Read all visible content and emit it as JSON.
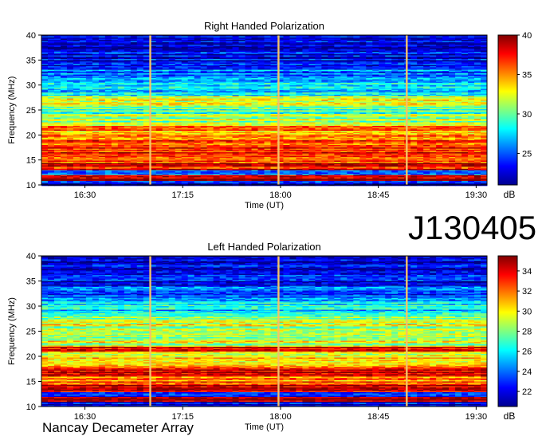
{
  "figure_label": "J130405",
  "footer": "Nancay Decameter Array",
  "chart_data": [
    {
      "type": "heatmap",
      "title": "Right Handed Polarization",
      "xlabel": "Time (UT)",
      "ylabel": "Frequency (MHz)",
      "xticks": [
        "16:30",
        "17:15",
        "18:00",
        "18:45",
        "19:30"
      ],
      "yticks": [
        "10",
        "15",
        "20",
        "25",
        "30",
        "35",
        "40"
      ],
      "ylim": [
        10,
        40
      ],
      "colorbar_label": "dB",
      "colorbar_ticks": [
        "25",
        "30",
        "35",
        "40"
      ],
      "colorbar_range": [
        21,
        40
      ],
      "band_levels": [
        {
          "freq_range": [
            10.0,
            11.0
          ],
          "level": 23
        },
        {
          "freq_range": [
            11.0,
            12.0
          ],
          "level": 39
        },
        {
          "freq_range": [
            12.0,
            13.0
          ],
          "level": 24
        },
        {
          "freq_range": [
            13.0,
            14.5
          ],
          "level": 38
        },
        {
          "freq_range": [
            14.5,
            16.0
          ],
          "level": 36
        },
        {
          "freq_range": [
            16.0,
            18.0
          ],
          "level": 37
        },
        {
          "freq_range": [
            18.0,
            20.0
          ],
          "level": 36
        },
        {
          "freq_range": [
            20.0,
            21.0
          ],
          "level": 34
        },
        {
          "freq_range": [
            21.0,
            22.0
          ],
          "level": 38
        },
        {
          "freq_range": [
            22.0,
            24.0
          ],
          "level": 31
        },
        {
          "freq_range": [
            24.0,
            26.0
          ],
          "level": 30
        },
        {
          "freq_range": [
            26.0,
            28.0
          ],
          "level": 32
        },
        {
          "freq_range": [
            28.0,
            31.0
          ],
          "level": 27
        },
        {
          "freq_range": [
            31.0,
            34.0
          ],
          "level": 25
        },
        {
          "freq_range": [
            34.0,
            40.0
          ],
          "level": 23
        }
      ],
      "vertical_markers_time": [
        "17:00",
        "17:59",
        "18:58"
      ]
    },
    {
      "type": "heatmap",
      "title": "Left Handed Polarization",
      "xlabel": "Time (UT)",
      "ylabel": "Frequency (MHz)",
      "xticks": [
        "16:30",
        "17:15",
        "18:00",
        "18:45",
        "19:30"
      ],
      "yticks": [
        "10",
        "15",
        "20",
        "25",
        "30",
        "35",
        "40"
      ],
      "ylim": [
        10,
        40
      ],
      "colorbar_label": "dB",
      "colorbar_ticks": [
        "22",
        "24",
        "26",
        "28",
        "30",
        "32",
        "34"
      ],
      "colorbar_range": [
        20.5,
        35.5
      ],
      "band_levels": [
        {
          "freq_range": [
            10.0,
            11.0
          ],
          "level": 22
        },
        {
          "freq_range": [
            11.0,
            12.0
          ],
          "level": 35
        },
        {
          "freq_range": [
            12.0,
            13.0
          ],
          "level": 23
        },
        {
          "freq_range": [
            13.0,
            14.5
          ],
          "level": 34
        },
        {
          "freq_range": [
            14.5,
            16.0
          ],
          "level": 32
        },
        {
          "freq_range": [
            16.0,
            18.0
          ],
          "level": 34
        },
        {
          "freq_range": [
            18.0,
            20.0
          ],
          "level": 31
        },
        {
          "freq_range": [
            20.0,
            21.0
          ],
          "level": 30
        },
        {
          "freq_range": [
            21.0,
            22.0
          ],
          "level": 34
        },
        {
          "freq_range": [
            22.0,
            24.0
          ],
          "level": 29
        },
        {
          "freq_range": [
            24.0,
            26.0
          ],
          "level": 28
        },
        {
          "freq_range": [
            26.0,
            28.0
          ],
          "level": 29
        },
        {
          "freq_range": [
            28.0,
            31.0
          ],
          "level": 26
        },
        {
          "freq_range": [
            31.0,
            34.0
          ],
          "level": 24
        },
        {
          "freq_range": [
            34.0,
            40.0
          ],
          "level": 22
        }
      ],
      "vertical_markers_time": [
        "17:00",
        "17:59",
        "18:58"
      ]
    }
  ]
}
